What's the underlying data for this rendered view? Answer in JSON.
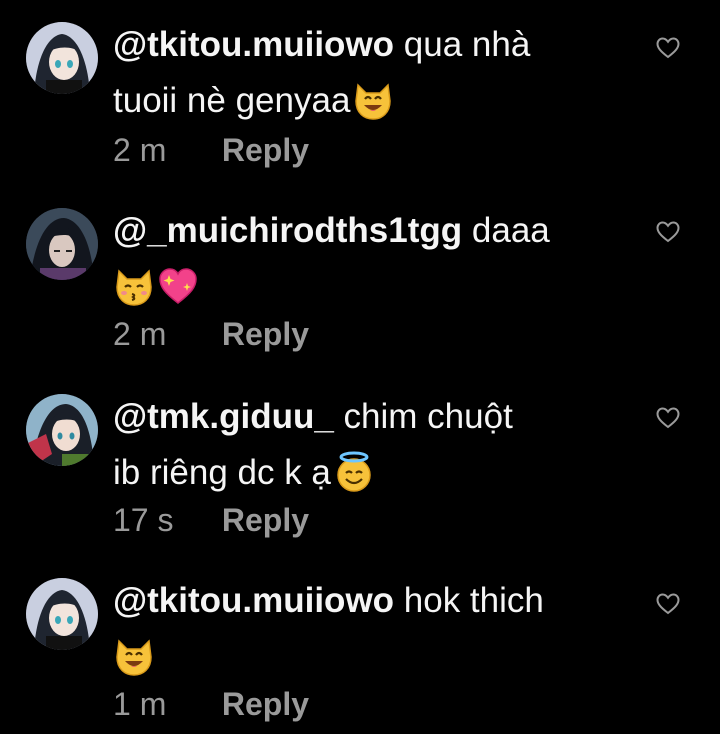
{
  "comments": [
    {
      "username": "@tkitou.muiiowo",
      "text_line1": "qua nhà",
      "text_line2": "tuoii nè genyaa",
      "emojis": [
        "smiling-cat"
      ],
      "time": "2 m",
      "reply_label": "Reply"
    },
    {
      "username": "@_muichirodths1tgg",
      "text_line1": "daaa",
      "text_line2": "",
      "emojis": [
        "kissing-cat",
        "sparkling-heart"
      ],
      "time": "2 m",
      "reply_label": "Reply"
    },
    {
      "username": "@tmk.giduu_",
      "text_line1": "chim chuột",
      "text_line2": "ib riêng dc k ạ",
      "emojis": [
        "smiling-face-with-halo"
      ],
      "time": "17 s",
      "reply_label": "Reply"
    },
    {
      "username": "@tkitou.muiiowo",
      "text_line1": "hok thich",
      "text_line2": "",
      "emojis": [
        "smiling-cat"
      ],
      "time": "1 m",
      "reply_label": "Reply"
    }
  ],
  "colors": {
    "background": "#000000",
    "text": "#f5f5f5",
    "meta": "#9a9a9a",
    "emoji_yellow": "#f7c23a"
  },
  "icons": {
    "like": "heart-outline-icon"
  }
}
